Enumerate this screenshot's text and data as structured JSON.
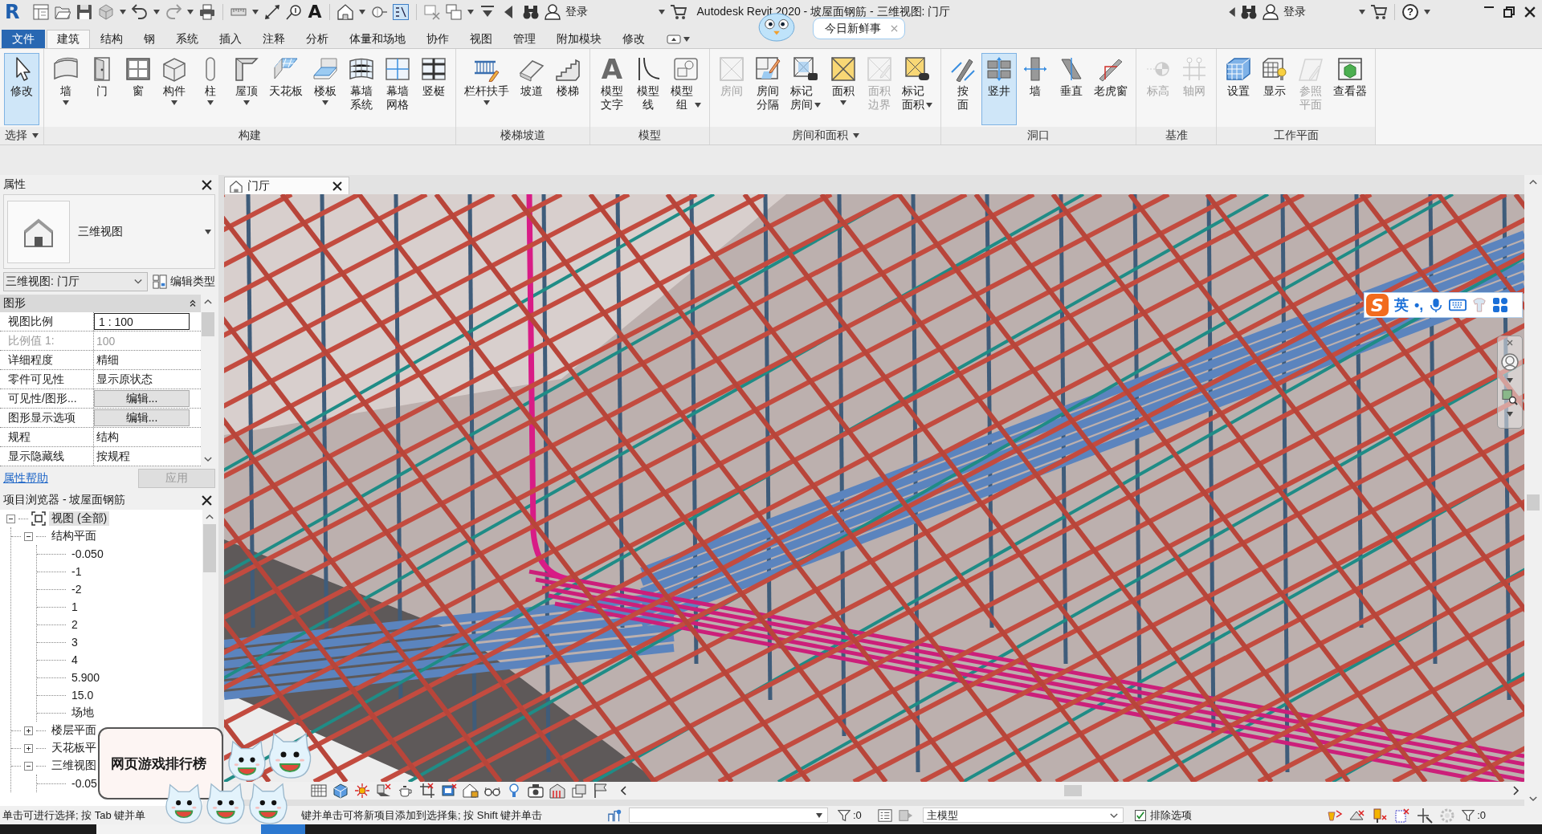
{
  "title_bar": {
    "logo": "R",
    "text_tool": "A",
    "login_left": "登录",
    "title": "Autodesk Revit 2020 - 坡屋面钢筋 - 三维视图: 门厅",
    "news": "今日新鲜事",
    "login_right": "登录",
    "help": "?"
  },
  "ribbon": {
    "tabs": [
      {
        "label": "文件",
        "kind": "file",
        "selected": false
      },
      {
        "label": "建筑",
        "kind": "tab",
        "selected": true
      },
      {
        "label": "结构",
        "kind": "tab",
        "selected": false
      },
      {
        "label": "钢",
        "kind": "tab",
        "selected": false
      },
      {
        "label": "系统",
        "kind": "tab",
        "selected": false
      },
      {
        "label": "插入",
        "kind": "tab",
        "selected": false
      },
      {
        "label": "注释",
        "kind": "tab",
        "selected": false
      },
      {
        "label": "分析",
        "kind": "tab",
        "selected": false
      },
      {
        "label": "体量和场地",
        "kind": "tab",
        "selected": false
      },
      {
        "label": "协作",
        "kind": "tab",
        "selected": false
      },
      {
        "label": "视图",
        "kind": "tab",
        "selected": false
      },
      {
        "label": "管理",
        "kind": "tab",
        "selected": false
      },
      {
        "label": "附加模块",
        "kind": "tab",
        "selected": false
      },
      {
        "label": "修改",
        "kind": "tab",
        "selected": false
      }
    ],
    "panels": [
      {
        "label": "选择",
        "menu": true,
        "buttons": [
          {
            "label": "修改",
            "kind": "single",
            "menu": false,
            "selected": true,
            "disabled": false
          }
        ]
      },
      {
        "label": "构建",
        "menu": false,
        "buttons": [
          {
            "label": "墙",
            "kind": "single",
            "menu": true,
            "selected": false,
            "disabled": false
          },
          {
            "label": "门",
            "kind": "single",
            "menu": false,
            "selected": false,
            "disabled": false
          },
          {
            "label": "窗",
            "kind": "single",
            "menu": false,
            "selected": false,
            "disabled": false
          },
          {
            "label": "构件",
            "kind": "single",
            "menu": true,
            "selected": false,
            "disabled": false
          },
          {
            "label": "柱",
            "kind": "single",
            "menu": true,
            "selected": false,
            "disabled": false
          },
          {
            "label": "屋顶",
            "kind": "single",
            "menu": true,
            "selected": false,
            "disabled": false
          },
          {
            "label": "天花板",
            "kind": "single",
            "menu": false,
            "selected": false,
            "disabled": false
          },
          {
            "label": "楼板",
            "kind": "single",
            "menu": true,
            "selected": false,
            "disabled": false
          },
          {
            "label": "幕墙系统",
            "kind": "stacked",
            "menu": false,
            "selected": false,
            "disabled": false
          },
          {
            "label": "幕墙网格",
            "kind": "stacked",
            "menu": false,
            "selected": false,
            "disabled": false
          },
          {
            "label": "竖梃",
            "kind": "single",
            "menu": false,
            "selected": false,
            "disabled": false
          }
        ]
      },
      {
        "label": "楼梯坡道",
        "menu": false,
        "buttons": [
          {
            "label": "栏杆扶手",
            "kind": "single",
            "menu": true,
            "selected": false,
            "disabled": false
          },
          {
            "label": "坡道",
            "kind": "single",
            "menu": false,
            "selected": false,
            "disabled": false
          },
          {
            "label": "楼梯",
            "kind": "single",
            "menu": false,
            "selected": false,
            "disabled": false
          }
        ]
      },
      {
        "label": "模型",
        "menu": false,
        "buttons": [
          {
            "label": "模型文字",
            "kind": "stacked",
            "glyph": "A",
            "menu": false,
            "selected": false,
            "disabled": false
          },
          {
            "label": "模型线",
            "kind": "stacked",
            "menu": false,
            "selected": false,
            "disabled": false
          },
          {
            "label": "模型组",
            "kind": "stacked",
            "menu": true,
            "selected": false,
            "disabled": false
          }
        ]
      },
      {
        "label": "房间和面积",
        "menu": true,
        "buttons": [
          {
            "label": "房间",
            "kind": "single",
            "menu": false,
            "selected": false,
            "disabled": true
          },
          {
            "label": "房间分隔",
            "kind": "stacked",
            "menu": false,
            "selected": false,
            "disabled": false
          },
          {
            "label": "标记房间",
            "kind": "stacked",
            "menu": true,
            "selected": false,
            "disabled": false
          },
          {
            "label": "面积",
            "kind": "single",
            "menu": true,
            "selected": false,
            "disabled": false
          },
          {
            "label": "面积边界",
            "kind": "stacked",
            "menu": false,
            "selected": false,
            "disabled": true
          },
          {
            "label": "标记面积",
            "kind": "stacked",
            "menu": true,
            "selected": false,
            "disabled": false
          }
        ]
      },
      {
        "label": "洞口",
        "menu": false,
        "buttons": [
          {
            "label": "按面",
            "kind": "stacked",
            "menu": false,
            "selected": false,
            "disabled": false
          },
          {
            "label": "竖井",
            "kind": "single",
            "menu": false,
            "selected": true,
            "disabled": false
          },
          {
            "label": "墙",
            "kind": "single",
            "menu": false,
            "selected": false,
            "disabled": false
          },
          {
            "label": "垂直",
            "kind": "single",
            "menu": false,
            "selected": false,
            "disabled": false
          },
          {
            "label": "老虎窗",
            "kind": "single",
            "menu": false,
            "selected": false,
            "disabled": false
          }
        ]
      },
      {
        "label": "基准",
        "menu": false,
        "buttons": [
          {
            "label": "标高",
            "kind": "single",
            "menu": false,
            "selected": false,
            "disabled": true
          },
          {
            "label": "轴网",
            "kind": "single",
            "menu": false,
            "selected": false,
            "disabled": true
          }
        ]
      },
      {
        "label": "工作平面",
        "menu": false,
        "buttons": [
          {
            "label": "设置",
            "kind": "single",
            "menu": false,
            "selected": false,
            "disabled": false
          },
          {
            "label": "显示",
            "kind": "single",
            "menu": false,
            "selected": false,
            "disabled": false
          },
          {
            "label": "参照平面",
            "kind": "stacked",
            "menu": false,
            "selected": false,
            "disabled": true
          },
          {
            "label": "查看器",
            "kind": "single",
            "menu": false,
            "selected": false,
            "disabled": false
          }
        ]
      }
    ]
  },
  "properties": {
    "title": "属性",
    "type_name": "三维视图",
    "view_selector": "三维视图: 门厅",
    "edit_type": "编辑类型",
    "group": {
      "label": "图形",
      "expanded": true
    },
    "rows": [
      {
        "name": "视图比例",
        "value": "1 : 100",
        "kind": "field",
        "disabled": false
      },
      {
        "name": "比例值 1:",
        "value": "100",
        "kind": "text",
        "disabled": true
      },
      {
        "name": "详细程度",
        "value": "精细",
        "kind": "text",
        "disabled": false
      },
      {
        "name": "零件可见性",
        "value": "显示原状态",
        "kind": "text",
        "disabled": false
      },
      {
        "name": "可见性/图形...",
        "value": "编辑...",
        "kind": "button",
        "disabled": false
      },
      {
        "name": "图形显示选项",
        "value": "编辑...",
        "kind": "button",
        "disabled": false
      },
      {
        "name": "规程",
        "value": "结构",
        "kind": "text",
        "disabled": false
      },
      {
        "name": "显示隐藏线",
        "value": "按规程",
        "kind": "text",
        "disabled": false
      }
    ],
    "help_link": "属性帮助",
    "apply": {
      "label": "应用",
      "disabled": true
    }
  },
  "browser": {
    "title": "项目浏览器 - 坡屋面钢筋",
    "tree": [
      {
        "label": "视图 (全部)",
        "expanded": true,
        "selected": true,
        "children": [
          {
            "label": "结构平面",
            "expanded": true,
            "selected": false,
            "children": [
              {
                "label": "-0.050",
                "selected": false
              },
              {
                "label": "-1",
                "selected": false
              },
              {
                "label": "-2",
                "selected": false
              },
              {
                "label": "1",
                "selected": false
              },
              {
                "label": "2",
                "selected": false
              },
              {
                "label": "3",
                "selected": false
              },
              {
                "label": "4",
                "selected": false
              },
              {
                "label": "5.900",
                "selected": false
              },
              {
                "label": "15.0",
                "selected": false
              },
              {
                "label": "场地",
                "selected": false
              }
            ]
          },
          {
            "label": "楼层平面",
            "expanded": false,
            "selected": false
          },
          {
            "label": "天花板平",
            "expanded": false,
            "selected": false
          },
          {
            "label": "三维视图",
            "expanded": true,
            "selected": false,
            "children": [
              {
                "label": "-0.05",
                "selected": false
              }
            ]
          }
        ]
      }
    ]
  },
  "view": {
    "tab": {
      "label": "门厅",
      "selected": true
    }
  },
  "ime_bar": {
    "logo": "S",
    "mode": "英",
    "punctuation": "•,"
  },
  "ad_popup": {
    "title": "网页游戏排行榜"
  },
  "status_bar": {
    "hint_left": "单击可进行选择; 按 Tab 键并单",
    "hint_right": "键并单击可将新项目添加到选择集; 按 Shift 键并单击",
    "filter_left": ":0",
    "design_option": "主模型",
    "exclude": {
      "label": "排除选项",
      "checked": true
    },
    "filter_right": ":0"
  }
}
